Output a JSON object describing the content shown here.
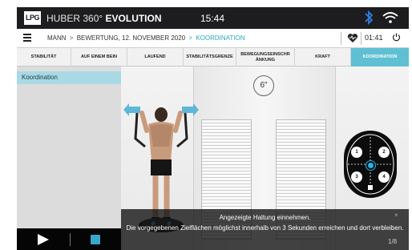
{
  "topbar": {
    "logo": "LPG",
    "brand_prefix": "HUBER 360°",
    "brand_bold": "EVOLUTION",
    "time": "15:44"
  },
  "breadcrumb": {
    "item1": "MANN",
    "item2": "BEWERTUNG, 12. NOVEMBER 2020",
    "current": "KOORDINATION",
    "sep": ">"
  },
  "session": {
    "timer": "01:41"
  },
  "tabs": [
    {
      "label": "STABILITÄT"
    },
    {
      "label": "AUF EINEM BEIN"
    },
    {
      "label": "LAUFEND"
    },
    {
      "label": "STABILITÄTSGRENZE"
    },
    {
      "label": "BEWEGUNGSEINSCHR ÄNKUNG"
    },
    {
      "label": "KRAFT"
    },
    {
      "label": "KOORDINATION",
      "active": true
    }
  ],
  "left_panel": {
    "item": "Koordination"
  },
  "scene": {
    "countdown": "6\"",
    "targets": [
      "1",
      "2",
      "3",
      "4"
    ]
  },
  "instruction": {
    "line1": "Angezeigte Haltung einnehmen.",
    "line2": "Die vorgegebenen Zielflächen möglichst innerhalb von 3 Sekunden erreichen und dort verbleiben.",
    "close": "×",
    "counter": "1/8"
  },
  "colors": {
    "accent": "#5fc0d4",
    "breadcrumb_active": "#2aa7c4",
    "topbar": "#1d1d1f",
    "stop": "#3aa6c8"
  }
}
